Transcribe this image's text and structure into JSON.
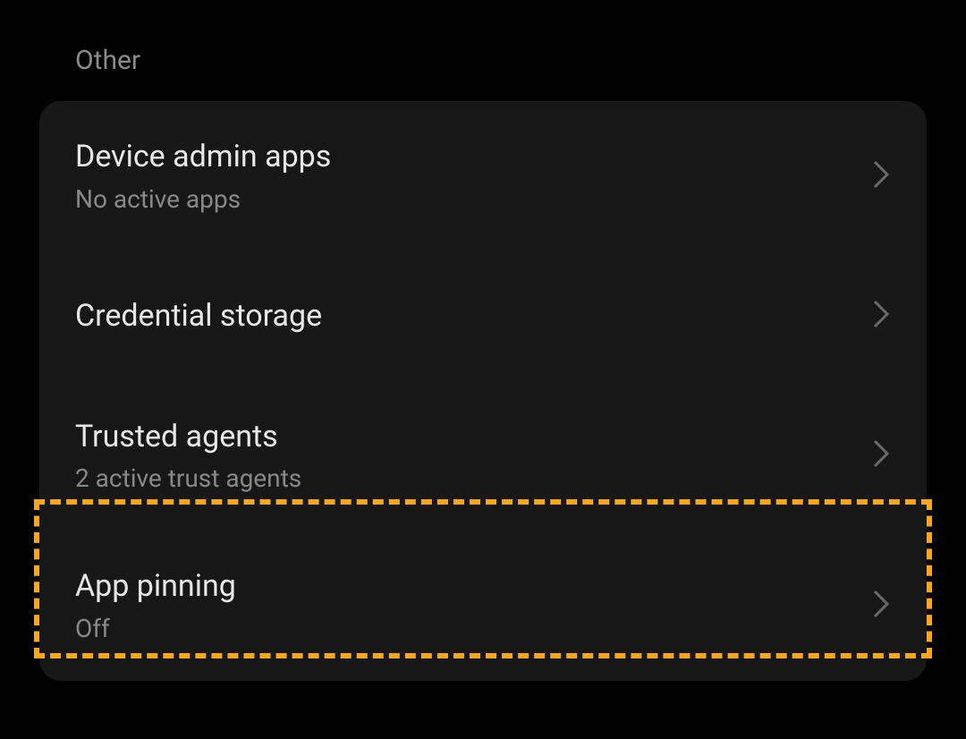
{
  "section": {
    "header": "Other",
    "items": [
      {
        "title": "Device admin apps",
        "subtitle": "No active apps"
      },
      {
        "title": "Credential storage",
        "subtitle": null
      },
      {
        "title": "Trusted agents",
        "subtitle": "2 active trust agents"
      },
      {
        "title": "App pinning",
        "subtitle": "Off"
      }
    ]
  },
  "highlight_color": "#f5a623"
}
